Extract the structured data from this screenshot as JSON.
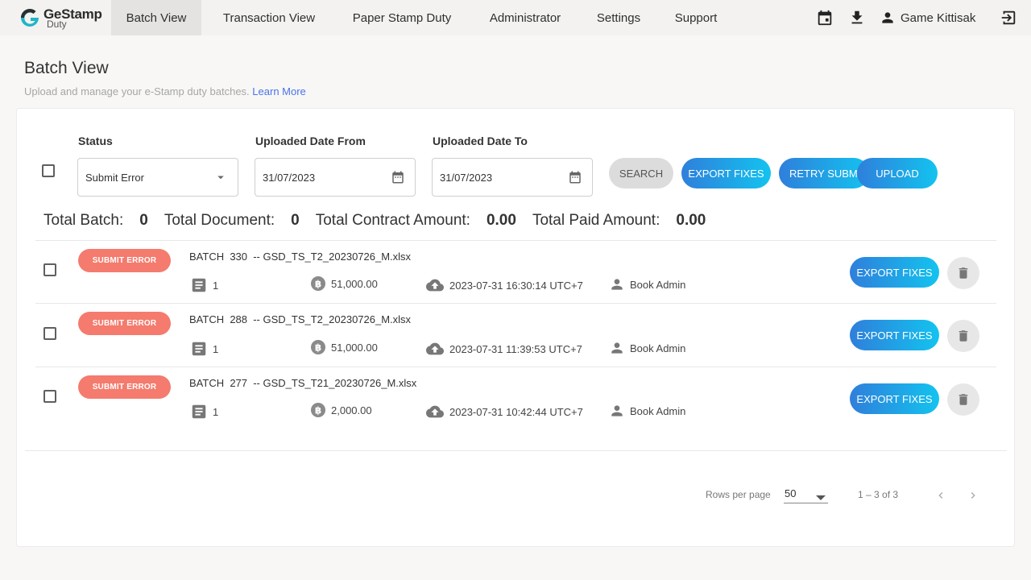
{
  "logo": {
    "name": "GeStamp",
    "sub": "Duty"
  },
  "nav": {
    "items": [
      {
        "label": "Batch View",
        "active": true
      },
      {
        "label": "Transaction View"
      },
      {
        "label": "Paper Stamp Duty"
      },
      {
        "label": "Administrator"
      },
      {
        "label": "Settings"
      },
      {
        "label": "Support"
      }
    ],
    "user_name": "Game Kittisak",
    "icons": [
      "calendar-icon",
      "download-icon",
      "person-icon",
      "logout-icon"
    ]
  },
  "header": {
    "title": "Batch View",
    "subtitle": "Upload and manage your e-Stamp duty batches.",
    "learn_more": "Learn More"
  },
  "filters": {
    "status_label": "Status",
    "status_value": "Submit Error",
    "from_label": "Uploaded Date From",
    "from_value": "31/07/2023",
    "to_label": "Uploaded Date To",
    "to_value": "31/07/2023",
    "search": "SEARCH",
    "export_fixes": "EXPORT FIXES",
    "retry_submit": "RETRY SUBMIT",
    "upload": "UPLOAD"
  },
  "totals": {
    "batch_label": "Total Batch:",
    "batch_value": "0",
    "document_label": "Total Document:",
    "document_value": "0",
    "contract_label": "Total Contract Amount:",
    "contract_value": "0.00",
    "paid_label": "Total Paid Amount:",
    "paid_value": "0.00"
  },
  "rows": [
    {
      "status": "SUBMIT ERROR",
      "batch": "BATCH  330  -- GSD_TS_T2_20230726_M.xlsx",
      "docs": "1",
      "amount": "51,000.00",
      "uploaded": "2023-07-31 16:30:14 UTC+7",
      "user": "Book Admin",
      "action": "EXPORT FIXES"
    },
    {
      "status": "SUBMIT ERROR",
      "batch": "BATCH  288  -- GSD_TS_T2_20230726_M.xlsx",
      "docs": "1",
      "amount": "51,000.00",
      "uploaded": "2023-07-31 11:39:53 UTC+7",
      "user": "Book Admin",
      "action": "EXPORT FIXES"
    },
    {
      "status": "SUBMIT ERROR",
      "batch": "BATCH  277  -- GSD_TS_T21_20230726_M.xlsx",
      "docs": "1",
      "amount": "2,000.00",
      "uploaded": "2023-07-31 10:42:44 UTC+7",
      "user": "Book Admin",
      "action": "EXPORT FIXES"
    }
  ],
  "pagination": {
    "rows_per_page_label": "Rows per page",
    "rows_per_page": "50",
    "range": "1 – 3 of 3"
  },
  "colors": {
    "accent_start": "#2f7fdb",
    "accent_end": "#13c3ef",
    "error_badge": "#f47b6e"
  }
}
